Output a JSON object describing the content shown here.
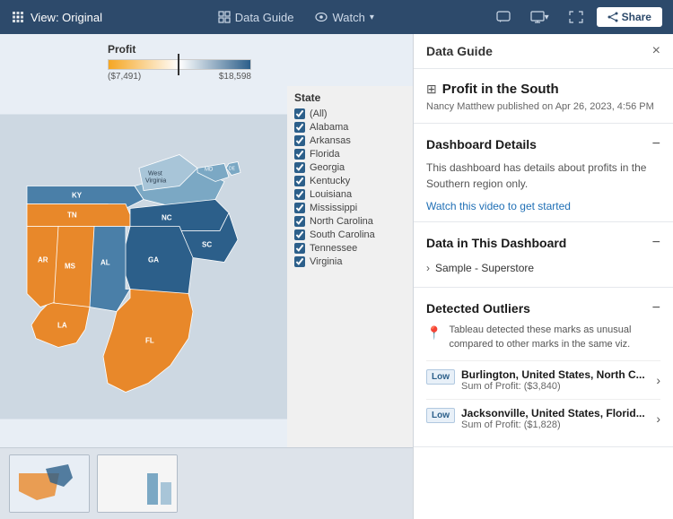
{
  "navbar": {
    "brand": "View: Original",
    "data_guide_label": "Data Guide",
    "watch_label": "Watch",
    "share_label": "Share"
  },
  "viz": {
    "legend_title": "Profit",
    "legend_min": "($7,491)",
    "legend_max": "$18,598",
    "filter_title": "State",
    "filter_items": [
      "(All)",
      "Alabama",
      "Arkansas",
      "Florida",
      "Georgia",
      "Kentucky",
      "Louisiana",
      "Mississippi",
      "North Carolina",
      "South Carolina",
      "Tennessee",
      "Virginia"
    ]
  },
  "data_guide": {
    "panel_title": "Data Guide",
    "close_icon": "×",
    "viz_icon": "⊞",
    "main_title": "Profit in the South",
    "meta": "Nancy Matthew published on Apr 26, 2023, 4:56 PM",
    "dashboard_details": {
      "title": "Dashboard Details",
      "description": "This dashboard has details about profits in the Southern region only.",
      "link": "Watch this video to get started"
    },
    "data_section": {
      "title": "Data in This Dashboard",
      "item": "Sample - Superstore"
    },
    "outliers": {
      "title": "Detected Outliers",
      "description": "Tableau detected these marks as unusual compared to other marks in the same viz.",
      "items": [
        {
          "badge": "Low",
          "name": "Burlington, United States, North C...",
          "value": "Sum of Profit: ($3,840)"
        },
        {
          "badge": "Low",
          "name": "Jacksonville, United States, Florid...",
          "value": "Sum of Profit: ($1,828)"
        }
      ]
    }
  }
}
